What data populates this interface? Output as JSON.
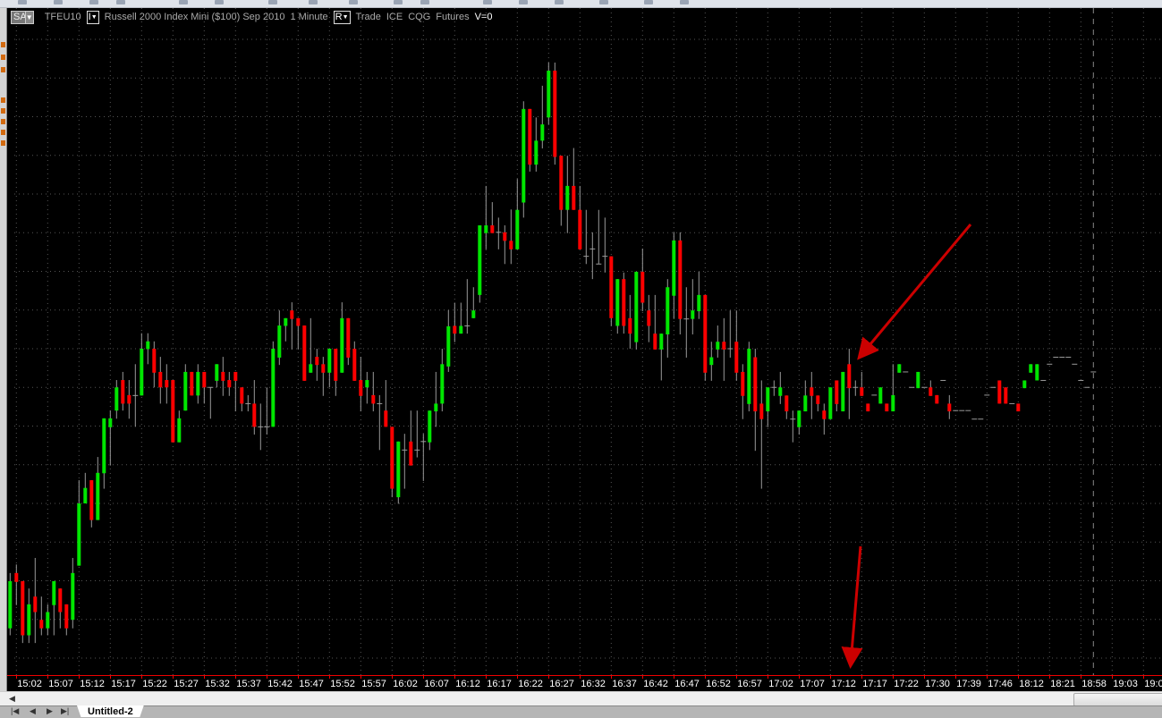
{
  "header": {
    "sa_button": "SA",
    "symbol": "TFEU10",
    "instrument_button": "I",
    "description": "Russell 2000 Index Mini ($100) Sep 2010",
    "interval": "1 Minute",
    "r_button": "R",
    "data_type": "Trade",
    "exchange": "ICE",
    "feed": "CQG",
    "market": "Futures",
    "volume": "V=0",
    "dropdown_icon": "chevron-down-icon"
  },
  "tabs": {
    "active": "Untitled-2",
    "nav_icons": [
      "first-icon",
      "prev-icon",
      "next-icon",
      "last-icon"
    ]
  },
  "colors": {
    "up": "#00e600",
    "down": "#ff0000",
    "doji": "#9a9a9a",
    "background": "#000000",
    "grid": "#555555",
    "annotation": "#cc0000",
    "axis_line": "#e00000"
  },
  "chart_data": {
    "type": "candlestick",
    "ohlc_order": [
      "open",
      "high",
      "low",
      "close"
    ],
    "price_axis": "none shown (values in relative grid units)",
    "ylim": [
      0,
      16
    ],
    "grid": true,
    "x_tick_labels": [
      "15:02",
      "15:07",
      "15:12",
      "15:17",
      "15:22",
      "15:27",
      "15:32",
      "15:37",
      "15:42",
      "15:47",
      "15:52",
      "15:57",
      "16:02",
      "16:07",
      "16:12",
      "16:17",
      "16:22",
      "16:27",
      "16:32",
      "16:37",
      "16:42",
      "16:47",
      "16:52",
      "16:57",
      "17:02",
      "17:07",
      "17:12",
      "17:17",
      "17:22",
      "17:30",
      "17:39",
      "17:46",
      "18:12",
      "18:21",
      "18:58",
      "19:03",
      "19:0"
    ],
    "annotations": [
      "red arrow pointing at candle near 17:13",
      "red arrow pointing down to 17:12 axis label"
    ],
    "candles": [
      [
        0.77,
        2.2,
        0.59,
        1.99
      ],
      [
        2.2,
        2.42,
        1.37,
        1.97
      ],
      [
        1.99,
        1.99,
        0.39,
        0.59
      ],
      [
        0.59,
        1.8,
        0.39,
        1.39
      ],
      [
        1.59,
        2.59,
        0.39,
        1.19
      ],
      [
        0.99,
        1.59,
        0.59,
        0.77
      ],
      [
        0.77,
        1.39,
        0.59,
        1.19
      ],
      [
        1.37,
        1.99,
        0.59,
        1.99
      ],
      [
        1.8,
        1.8,
        0.77,
        1.19
      ],
      [
        1.39,
        1.39,
        0.59,
        0.77
      ],
      [
        0.99,
        2.59,
        0.77,
        2.2
      ],
      [
        2.39,
        4.6,
        2.39,
        4.0
      ],
      [
        4.0,
        4.79,
        4.0,
        4.4
      ],
      [
        4.6,
        4.6,
        3.38,
        3.57
      ],
      [
        3.57,
        5.2,
        3.57,
        4.79
      ],
      [
        4.78,
        6.2,
        4.38,
        6.2
      ],
      [
        5.97,
        6.4,
        4.98,
        6.2
      ],
      [
        6.4,
        7.19,
        6.19,
        7.0
      ],
      [
        7.19,
        7.4,
        6.4,
        6.58
      ],
      [
        6.8,
        7.19,
        6.19,
        6.58
      ],
      [
        6.79,
        7.6,
        5.98,
        6.79
      ],
      [
        6.79,
        8.4,
        6.79,
        8.0
      ],
      [
        7.99,
        8.4,
        7.6,
        8.19
      ],
      [
        8.0,
        8.19,
        7.0,
        7.38
      ],
      [
        7.4,
        7.79,
        6.58,
        7.0
      ],
      [
        7.19,
        7.6,
        6.58,
        7.0
      ],
      [
        7.19,
        7.19,
        5.58,
        5.58
      ],
      [
        5.58,
        6.4,
        5.58,
        6.2
      ],
      [
        6.4,
        7.6,
        6.4,
        7.4
      ],
      [
        7.4,
        7.4,
        6.79,
        6.79
      ],
      [
        6.79,
        7.6,
        6.58,
        7.4
      ],
      [
        7.4,
        7.4,
        6.58,
        7.0
      ],
      [
        7.0,
        7.0,
        6.19,
        7.0
      ],
      [
        7.17,
        7.6,
        7.0,
        7.6
      ],
      [
        7.4,
        7.79,
        6.78,
        7.17
      ],
      [
        7.19,
        7.4,
        6.78,
        7.0
      ],
      [
        7.4,
        7.4,
        6.38,
        7.17
      ],
      [
        7.0,
        7.0,
        6.38,
        6.58
      ],
      [
        6.58,
        6.8,
        6.38,
        6.58
      ],
      [
        6.58,
        7.19,
        5.78,
        5.98
      ],
      [
        5.98,
        6.58,
        5.38,
        5.98
      ],
      [
        5.98,
        7.0,
        5.78,
        5.98
      ],
      [
        5.98,
        8.19,
        5.98,
        8.0
      ],
      [
        7.77,
        8.99,
        7.58,
        8.6
      ],
      [
        8.59,
        8.79,
        8.19,
        8.79
      ],
      [
        8.99,
        9.2,
        7.98,
        8.77
      ],
      [
        8.79,
        8.79,
        7.98,
        8.59
      ],
      [
        8.6,
        8.6,
        7.17,
        7.17
      ],
      [
        7.38,
        8.79,
        7.38,
        7.6
      ],
      [
        7.79,
        8.0,
        7.17,
        7.58
      ],
      [
        7.6,
        7.79,
        6.78,
        7.38
      ],
      [
        7.38,
        8.0,
        7.0,
        8.0
      ],
      [
        8.0,
        8.0,
        6.78,
        7.17
      ],
      [
        7.38,
        9.2,
        7.38,
        8.79
      ],
      [
        8.79,
        8.79,
        7.58,
        7.77
      ],
      [
        8.0,
        8.19,
        7.17,
        7.17
      ],
      [
        7.19,
        7.79,
        6.38,
        6.78
      ],
      [
        7.0,
        7.4,
        6.58,
        7.19
      ],
      [
        6.8,
        7.4,
        6.38,
        6.58
      ],
      [
        6.58,
        6.8,
        5.38,
        6.58
      ],
      [
        6.4,
        7.19,
        5.98,
        5.98
      ],
      [
        5.98,
        5.98,
        4.16,
        4.38
      ],
      [
        4.16,
        5.6,
        3.99,
        5.6
      ],
      [
        5.38,
        5.8,
        4.38,
        5.38
      ],
      [
        5.6,
        6.4,
        4.98,
        4.98
      ],
      [
        5.38,
        6.4,
        5.19,
        5.38
      ],
      [
        5.6,
        5.8,
        4.58,
        5.6
      ],
      [
        5.58,
        6.4,
        5.38,
        6.4
      ],
      [
        6.38,
        7.4,
        5.98,
        6.58
      ],
      [
        6.58,
        8.0,
        6.38,
        7.6
      ],
      [
        7.54,
        9.0,
        7.4,
        8.58
      ],
      [
        8.59,
        9.19,
        8.17,
        8.39
      ],
      [
        8.39,
        9.19,
        8.39,
        8.59
      ],
      [
        8.59,
        9.8,
        8.39,
        8.59
      ],
      [
        8.79,
        9.59,
        8.79,
        8.99
      ],
      [
        9.39,
        11.19,
        9.19,
        11.19
      ],
      [
        10.99,
        12.21,
        10.57,
        11.19
      ],
      [
        11.19,
        11.79,
        10.99,
        10.99
      ],
      [
        11.01,
        11.39,
        10.57,
        11.01
      ],
      [
        11.01,
        11.19,
        10.19,
        10.79
      ],
      [
        10.79,
        11.6,
        10.19,
        10.57
      ],
      [
        10.57,
        12.39,
        10.57,
        11.59
      ],
      [
        11.78,
        14.4,
        11.39,
        14.2
      ],
      [
        14.2,
        14.2,
        12.58,
        12.76
      ],
      [
        12.76,
        13.98,
        12.58,
        13.38
      ],
      [
        13.38,
        14.8,
        13.18,
        13.8
      ],
      [
        13.98,
        15.4,
        13.8,
        15.19
      ],
      [
        15.19,
        15.4,
        12.76,
        12.96
      ],
      [
        12.99,
        12.99,
        11.18,
        11.59
      ],
      [
        11.59,
        12.99,
        10.99,
        12.21
      ],
      [
        12.21,
        13.19,
        11.59,
        11.59
      ],
      [
        11.59,
        12.21,
        10.57,
        10.57
      ],
      [
        10.39,
        11.59,
        10.19,
        10.39
      ],
      [
        10.58,
        11.01,
        9.8,
        10.58
      ],
      [
        10.19,
        11.59,
        10.19,
        10.19
      ],
      [
        10.39,
        11.39,
        9.97,
        10.39
      ],
      [
        10.39,
        10.39,
        8.59,
        8.79
      ],
      [
        8.59,
        9.8,
        8.39,
        9.8
      ],
      [
        9.8,
        9.97,
        8.39,
        8.59
      ],
      [
        8.79,
        9.39,
        8.0,
        8.39
      ],
      [
        8.17,
        9.99,
        7.98,
        9.99
      ],
      [
        9.99,
        10.59,
        8.97,
        9.19
      ],
      [
        8.99,
        9.39,
        8.17,
        8.59
      ],
      [
        8.39,
        9.39,
        7.98,
        7.98
      ],
      [
        7.98,
        8.39,
        7.18,
        8.39
      ],
      [
        8.37,
        9.8,
        7.77,
        9.59
      ],
      [
        9.37,
        11.01,
        8.77,
        10.8
      ],
      [
        10.8,
        11.01,
        8.37,
        8.77
      ],
      [
        8.77,
        9.59,
        7.77,
        8.77
      ],
      [
        8.77,
        9.8,
        8.37,
        8.99
      ],
      [
        8.97,
        9.99,
        8.77,
        9.39
      ],
      [
        9.39,
        9.39,
        7.17,
        7.38
      ],
      [
        7.58,
        8.18,
        7.17,
        7.78
      ],
      [
        7.98,
        8.6,
        7.77,
        8.18
      ],
      [
        8.18,
        8.79,
        7.17,
        7.98
      ],
      [
        8.0,
        8.99,
        7.77,
        8.0
      ],
      [
        8.18,
        8.99,
        7.17,
        7.38
      ],
      [
        7.4,
        7.6,
        6.18,
        6.78
      ],
      [
        6.57,
        8.18,
        6.38,
        8.0
      ],
      [
        7.78,
        8.0,
        5.36,
        6.38
      ],
      [
        6.58,
        7.18,
        4.38,
        6.18
      ],
      [
        6.38,
        7.0,
        5.97,
        7.0
      ],
      [
        7.0,
        7.18,
        6.78,
        7.0
      ],
      [
        6.78,
        7.4,
        6.57,
        7.0
      ],
      [
        6.79,
        6.79,
        6.18,
        6.38
      ],
      [
        6.18,
        6.4,
        5.58,
        6.18
      ],
      [
        5.97,
        6.4,
        5.78,
        6.4
      ],
      [
        6.38,
        7.18,
        6.38,
        6.79
      ],
      [
        7.0,
        7.4,
        6.18,
        6.78
      ],
      [
        6.79,
        6.79,
        6.38,
        6.57
      ],
      [
        6.4,
        6.58,
        5.78,
        6.18
      ],
      [
        6.18,
        7.0,
        6.18,
        7.0
      ],
      [
        7.18,
        7.18,
        6.38,
        6.57
      ],
      [
        6.38,
        7.4,
        6.38,
        7.4
      ],
      [
        7.6,
        8.0,
        6.18,
        6.98
      ],
      [
        7.0,
        7.18,
        6.78,
        7.0
      ],
      [
        7.0,
        7.4,
        6.78,
        6.78
      ],
      [
        6.58,
        6.58,
        6.38,
        6.38
      ],
      [
        6.8,
        6.8,
        6.8,
        6.8
      ],
      [
        6.58,
        7.0,
        6.58,
        7.0
      ],
      [
        6.58,
        6.58,
        6.38,
        6.38
      ],
      [
        6.38,
        7.6,
        6.38,
        6.8
      ],
      [
        7.38,
        7.6,
        7.38,
        7.6
      ],
      [
        7.4,
        7.4,
        7.4,
        7.4
      ],
      [
        7.0,
        7.0,
        7.0,
        7.0
      ],
      [
        6.98,
        7.4,
        6.98,
        7.4
      ],
      [
        7.0,
        7.0,
        7.0,
        7.0
      ],
      [
        7.0,
        7.18,
        6.78,
        6.78
      ],
      [
        6.8,
        6.8,
        6.58,
        6.58
      ],
      [
        7.18,
        7.18,
        7.18,
        7.18
      ],
      [
        6.58,
        6.8,
        6.18,
        6.38
      ],
      [
        6.4,
        6.4,
        6.4,
        6.4
      ],
      [
        6.4,
        6.4,
        6.4,
        6.4
      ],
      [
        6.4,
        6.4,
        6.4,
        6.4
      ],
      [
        6.18,
        6.18,
        6.18,
        6.18
      ],
      [
        6.18,
        6.18,
        6.18,
        6.18
      ],
      [
        6.8,
        6.8,
        6.8,
        6.8
      ],
      [
        7.0,
        7.0,
        7.0,
        7.0
      ],
      [
        7.18,
        7.18,
        6.58,
        6.58
      ],
      [
        7.0,
        7.0,
        6.58,
        6.58
      ],
      [
        6.58,
        6.58,
        6.58,
        6.58
      ],
      [
        6.58,
        6.58,
        6.38,
        6.38
      ],
      [
        6.98,
        7.18,
        6.98,
        7.18
      ],
      [
        7.38,
        7.6,
        7.38,
        7.6
      ],
      [
        7.18,
        7.6,
        7.18,
        7.6
      ],
      [
        7.18,
        7.18,
        7.18,
        7.18
      ],
      [
        7.6,
        7.6,
        7.6,
        7.6
      ],
      [
        7.78,
        7.78,
        7.78,
        7.78
      ],
      [
        7.78,
        7.78,
        7.78,
        7.78
      ],
      [
        7.78,
        7.78,
        7.78,
        7.78
      ],
      [
        7.6,
        7.6,
        7.6,
        7.6
      ],
      [
        7.18,
        7.18,
        7.18,
        7.18
      ],
      [
        7.0,
        7.0,
        7.0,
        7.0
      ],
      [
        7.4,
        7.4,
        7.4,
        7.4
      ]
    ]
  }
}
